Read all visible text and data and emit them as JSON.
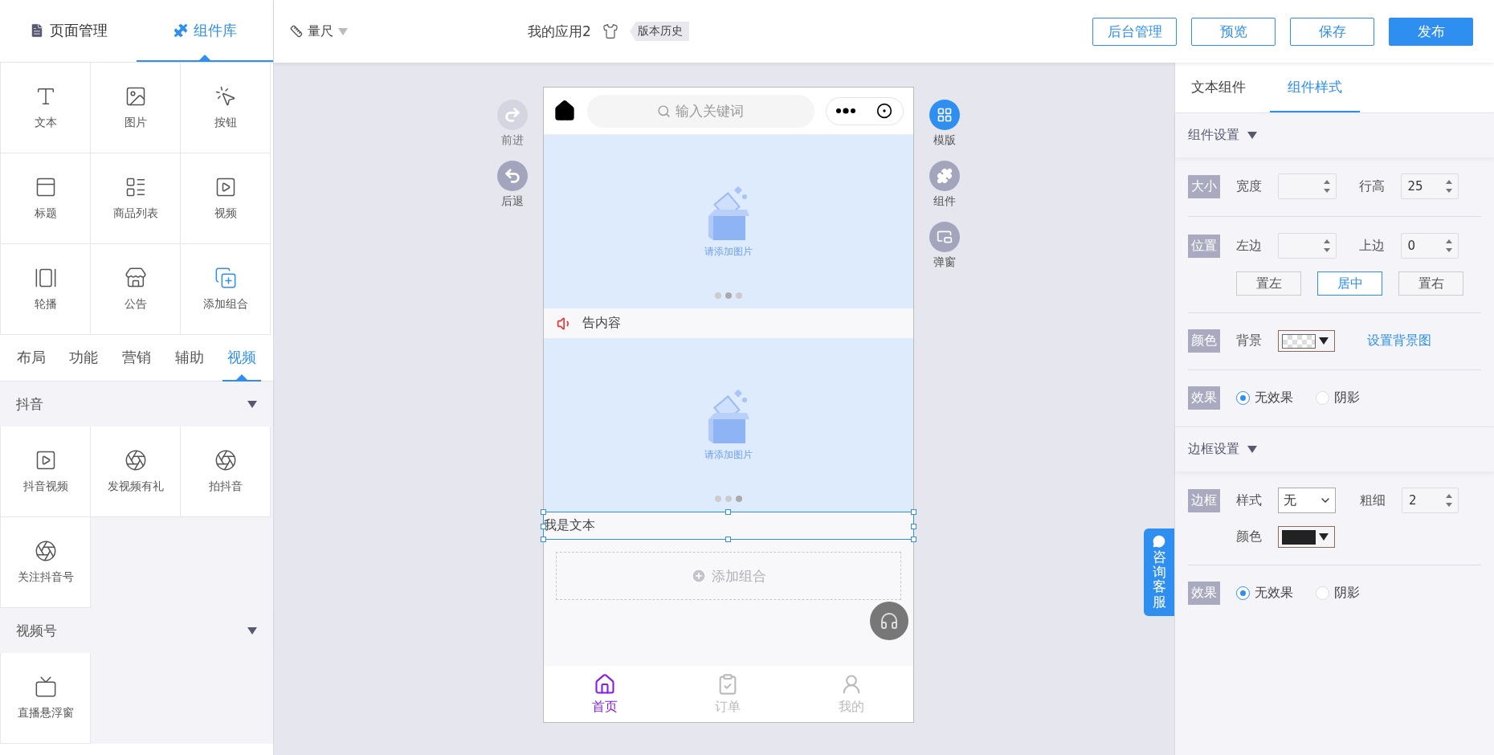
{
  "left_panel": {
    "tabs": [
      {
        "label": "页面管理",
        "selected": false
      },
      {
        "label": "组件库",
        "selected": true
      }
    ],
    "basic_components": [
      {
        "label": "文本"
      },
      {
        "label": "图片"
      },
      {
        "label": "按钮"
      },
      {
        "label": "标题"
      },
      {
        "label": "商品列表"
      },
      {
        "label": "视频"
      },
      {
        "label": "轮播"
      },
      {
        "label": "公告"
      },
      {
        "label": "添加组合"
      }
    ],
    "categories": [
      {
        "label": "布局",
        "selected": false
      },
      {
        "label": "功能",
        "selected": false
      },
      {
        "label": "营销",
        "selected": false
      },
      {
        "label": "辅助",
        "selected": false
      },
      {
        "label": "视频",
        "selected": true
      }
    ],
    "groups": [
      {
        "title": "抖音",
        "items": [
          {
            "label": "抖音视频"
          },
          {
            "label": "发视频有礼"
          },
          {
            "label": "拍抖音"
          },
          {
            "label": "关注抖音号"
          }
        ]
      },
      {
        "title": "视频号",
        "items": [
          {
            "label": "直播悬浮窗"
          }
        ]
      }
    ]
  },
  "toolbar": {
    "ruler": "量尺",
    "app_name": "我的应用2",
    "history": "版本历史",
    "buttons": [
      {
        "label": "后台管理",
        "primary": false
      },
      {
        "label": "预览",
        "primary": false
      },
      {
        "label": "保存",
        "primary": false
      },
      {
        "label": "发布",
        "primary": true
      }
    ]
  },
  "canvas": {
    "left_actions": [
      {
        "label": "前进",
        "disabled": true
      },
      {
        "label": "后退",
        "disabled": false
      }
    ],
    "right_actions": [
      {
        "label": "模版",
        "selected": true
      },
      {
        "label": "组件",
        "selected": false
      },
      {
        "label": "弹窗",
        "selected": false
      }
    ],
    "phone": {
      "search": {
        "placeholder": "输入关键词"
      },
      "blocks": [
        {
          "kind": "banner",
          "caption": "请添加图片",
          "dots": [
            {
              "selected": false
            },
            {
              "selected": true
            },
            {
              "selected": false
            }
          ]
        },
        {
          "kind": "notice",
          "text": "告内容"
        },
        {
          "kind": "banner",
          "caption": "请添加图片",
          "dots": [
            {
              "selected": false
            },
            {
              "selected": false
            },
            {
              "selected": true
            }
          ]
        },
        {
          "kind": "text",
          "text": "我是文本",
          "selected": true
        },
        {
          "kind": "add",
          "label": "添加组合"
        }
      ],
      "tab_bar": [
        {
          "label": "首页",
          "selected": true
        },
        {
          "label": "订单",
          "selected": false
        },
        {
          "label": "我的",
          "selected": false
        }
      ]
    },
    "service_tab": "咨询客服"
  },
  "style_panel": {
    "tabs": [
      {
        "label": "文本组件",
        "selected": false
      },
      {
        "label": "组件样式",
        "selected": true
      }
    ],
    "sections": [
      {
        "title": "组件设置",
        "groups": [
          {
            "kind": "spinners",
            "tag": "大小",
            "fields": [
              {
                "label": "宽度"
              },
              {
                "label": "行高",
                "value": "25"
              }
            ]
          },
          {
            "kind": "spinners",
            "tag": "位置",
            "fields": [
              {
                "label": "左边"
              },
              {
                "label": "上边",
                "value": "0"
              }
            ],
            "align": [
              {
                "label": "置左",
                "selected": false
              },
              {
                "label": "居中",
                "selected": true
              },
              {
                "label": "置右",
                "selected": false
              }
            ]
          },
          {
            "kind": "background",
            "tag": "颜色",
            "label": "背景",
            "link": "设置背景图"
          },
          {
            "kind": "radios",
            "tag": "效果",
            "options": [
              {
                "label": "无效果",
                "selected": true
              },
              {
                "label": "阴影",
                "selected": false
              }
            ]
          }
        ]
      },
      {
        "title": "边框设置",
        "groups": [
          {
            "kind": "border",
            "tag": "边框",
            "style_label": "样式",
            "style_value": "无",
            "width_label": "粗细",
            "width_value": "2",
            "color_label": "颜色",
            "color": "#222222"
          },
          {
            "kind": "radios",
            "tag": "效果",
            "options": [
              {
                "label": "无效果",
                "selected": true
              },
              {
                "label": "阴影",
                "selected": false
              }
            ]
          }
        ]
      }
    ]
  }
}
